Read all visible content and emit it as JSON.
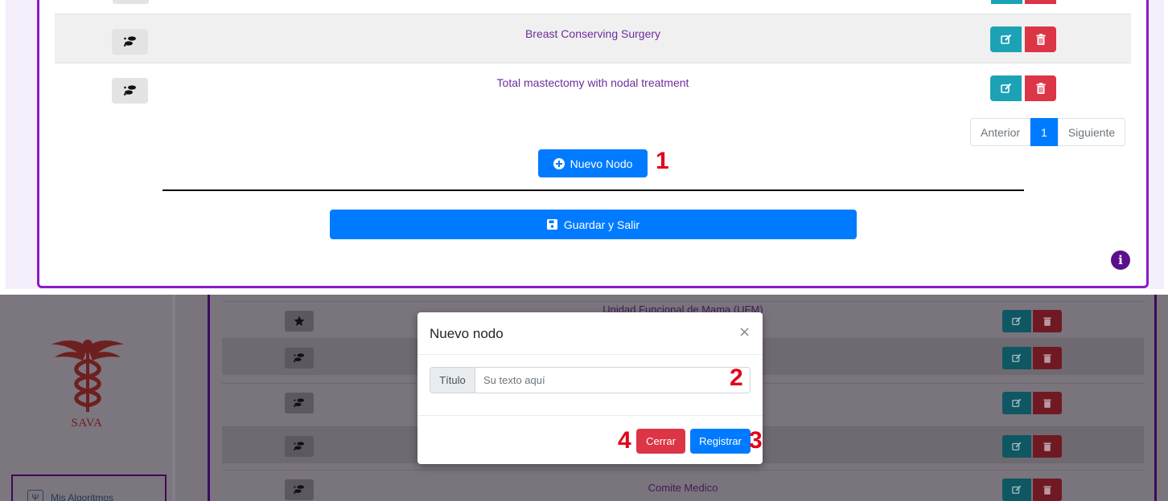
{
  "top": {
    "rows": [
      {
        "name": "Breast Conserving Surgery"
      },
      {
        "name": "Total mastectomy with nodal treatment"
      }
    ],
    "pagination": {
      "prev": "Anterior",
      "current": "1",
      "next": "Siguiente"
    },
    "new_node_button": "Nuevo Nodo",
    "save_exit_button": "Guardar y Salir"
  },
  "bottom": {
    "sidebar": {
      "brand": "SAVA",
      "menu_item": "Mis Algoritmos"
    },
    "rows": [
      {
        "name": "Unidad Funcional de Mama (UFM)",
        "icon": "star-icon"
      },
      {
        "name": "",
        "icon": "footprints-icon"
      },
      {
        "name": "",
        "icon": "footprints-icon"
      },
      {
        "name": "",
        "icon": "footprints-icon"
      },
      {
        "name": "Comite Medico",
        "icon": "footprints-icon"
      }
    ],
    "modal": {
      "title": "Nuevo nodo",
      "close_symbol": "×",
      "field_label": "Título",
      "field_placeholder": "Su texto aquí",
      "field_value": "",
      "cancel_button": "Cerrar",
      "submit_button": "Registrar"
    }
  },
  "callouts": {
    "c1": "1",
    "c2": "2",
    "c3": "3",
    "c4": "4"
  },
  "colors": {
    "accent_purple": "#8a1bc7",
    "primary_blue": "#007bff",
    "info_teal": "#1ba2b5",
    "danger_red": "#dc3545",
    "row_text": "#6f2d9b",
    "callout_red": "#e3001b"
  }
}
